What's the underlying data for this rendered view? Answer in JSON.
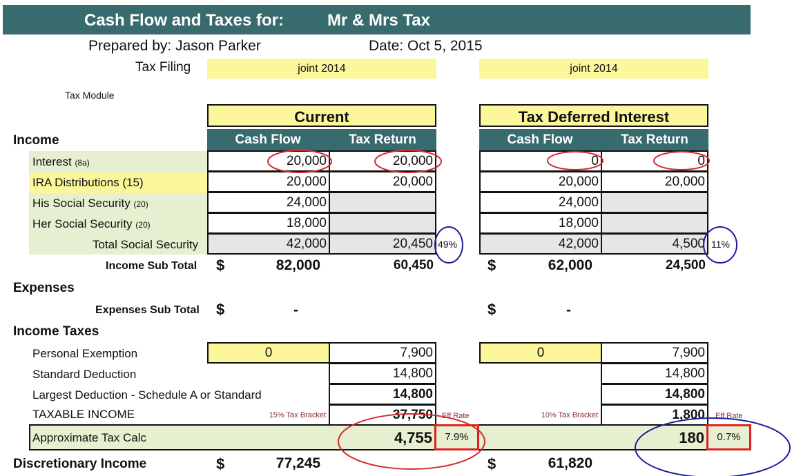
{
  "header": {
    "title_prefix": "Cash Flow and Taxes for:",
    "client": "Mr & Mrs Tax",
    "prepared_by": "Prepared by:  Jason Parker",
    "date": "Date:  Oct 5, 2015",
    "tax_filing_label": "Tax Filing",
    "tax_filing_current": "joint 2014",
    "tax_filing_deferred": "joint 2014",
    "module_label": "Tax Module"
  },
  "sections": {
    "income": "Income",
    "expenses": "Expenses",
    "income_taxes": "Income Taxes",
    "discretionary": "Discretionary Income"
  },
  "tables": {
    "current": {
      "title": "Current",
      "col1": "Cash Flow",
      "col2": "Tax Return"
    },
    "deferred": {
      "title": "Tax Deferred Interest",
      "col1": "Cash Flow",
      "col2": "Tax Return"
    }
  },
  "income_rows": [
    {
      "label": "Interest",
      "note": "(8a)",
      "cur_cf": "20,000",
      "cur_tr": "20,000",
      "def_cf": "0",
      "def_tr": "0"
    },
    {
      "label": "IRA Distributions (15)",
      "note": "",
      "cur_cf": "20,000",
      "cur_tr": "20,000",
      "def_cf": "20,000",
      "def_tr": "20,000"
    },
    {
      "label": "His Social Security",
      "note": "(20)",
      "cur_cf": "24,000",
      "cur_tr": "",
      "def_cf": "24,000",
      "def_tr": ""
    },
    {
      "label": "Her Social Security",
      "note": "(20)",
      "cur_cf": "18,000",
      "cur_tr": "",
      "def_cf": "18,000",
      "def_tr": ""
    },
    {
      "label": "Total Social Security",
      "note": "",
      "cur_cf": "42,000",
      "cur_tr": "20,450",
      "def_cf": "42,000",
      "def_tr": "4,500"
    }
  ],
  "ss_taxable_pct": {
    "current": "49%",
    "deferred": "11%"
  },
  "income_subtotal": {
    "label": "Income Sub Total",
    "currency": "$",
    "cur_cf": "82,000",
    "cur_tr": "60,450",
    "def_cf": "62,000",
    "def_tr": "24,500"
  },
  "expenses_subtotal": {
    "label": "Expenses Sub Total",
    "currency": "$",
    "cur": "-",
    "def": "-"
  },
  "tax_rows": {
    "personal_exemption": {
      "label": "Personal Exemption",
      "cur_input": "0",
      "cur_val": "7,900",
      "def_input": "0",
      "def_val": "7,900"
    },
    "standard_deduction": {
      "label": "Standard Deduction",
      "cur_val": "14,800",
      "def_val": "14,800"
    },
    "largest_deduction": {
      "label": "Largest Deduction - Schedule A or Standard",
      "cur_val": "14,800",
      "def_val": "14,800"
    },
    "taxable_income": {
      "label": "TAXABLE INCOME",
      "cur_bracket": "15% Tax Bracket",
      "cur_val": "37,750",
      "def_bracket": "10% Tax Bracket",
      "def_val": "1,800",
      "eff_rate_label": "Eff Rate"
    },
    "approx_tax": {
      "label": "Approximate Tax Calc",
      "cur_val": "4,755",
      "cur_eff": "7.9%",
      "def_val": "180",
      "def_eff": "0.7%"
    }
  },
  "discretionary": {
    "currency": "$",
    "cur": "77,245",
    "def": "61,820"
  },
  "annotation_colors": {
    "red": "#d42a2a",
    "blue": "#1c1c9c",
    "box_red": "#e02020"
  }
}
